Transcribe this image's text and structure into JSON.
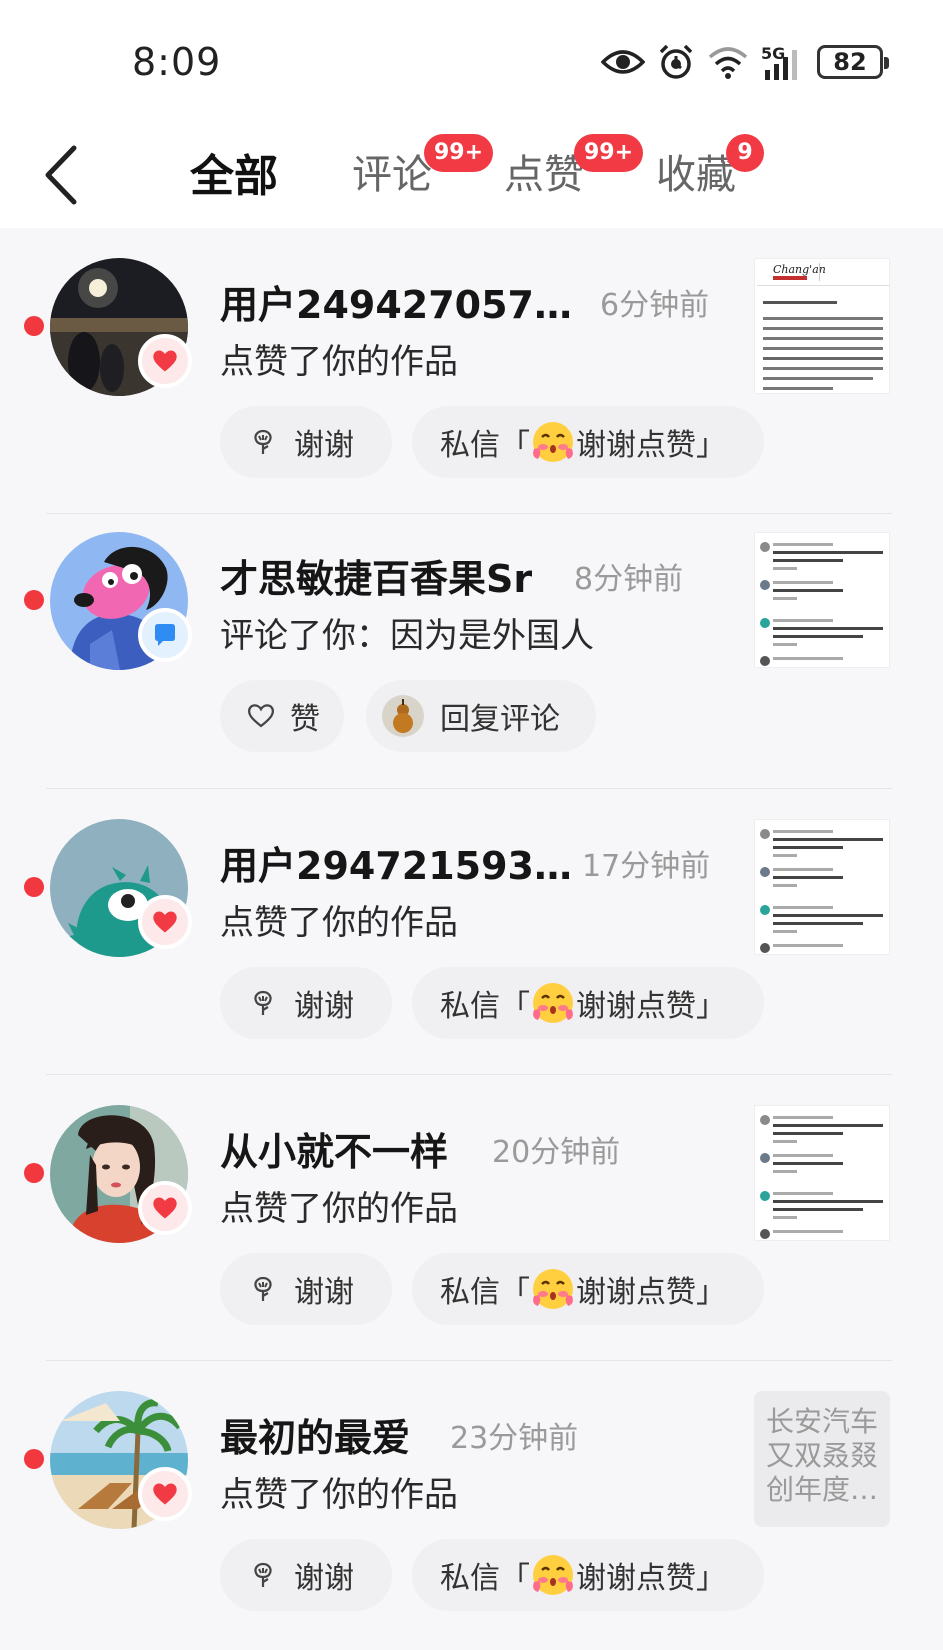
{
  "status_bar": {
    "time": "8:09",
    "network": "5G",
    "battery": "82",
    "icons": [
      "eye-icon",
      "alarm-icon",
      "wifi-icon",
      "signal-icon",
      "battery-icon"
    ]
  },
  "header": {
    "back_icon": "chevron-left-icon",
    "tabs": [
      {
        "label": "全部",
        "active": true,
        "badge": ""
      },
      {
        "label": "评论",
        "active": false,
        "badge": "99+"
      },
      {
        "label": "点赞",
        "active": false,
        "badge": "99+"
      },
      {
        "label": "收藏",
        "active": false,
        "badge": "9"
      }
    ]
  },
  "colors": {
    "accent": "#f23a44",
    "unread_dot": "#f2383f",
    "pill_bg": "#f0f0f2",
    "muted_text": "#9a9a9a"
  },
  "notifications": [
    {
      "user": "用户249427057…",
      "time": "6分钟前",
      "action": "点赞了你的作品",
      "badge_icon": "heart-icon",
      "thumb_kind": "article",
      "thumb_header": "Chang'an",
      "buttons": [
        {
          "icon": "thanks-flower-icon",
          "label": "谢谢"
        },
        {
          "icon": "blush-emoji-icon",
          "label": "私信「",
          "emoji_label": "谢谢点赞」"
        }
      ]
    },
    {
      "user": "才思敏捷百香果Sr",
      "time": "8分钟前",
      "action": "评论了你：因为是外国人",
      "badge_icon": "comment-bubble-icon",
      "thumb_kind": "comments",
      "buttons": [
        {
          "icon": "heart-outline-icon",
          "label": "赞"
        },
        {
          "icon": "gourd-avatar-icon",
          "label": "回复评论"
        }
      ]
    },
    {
      "user": "用户294721593…",
      "time": "17分钟前",
      "action": "点赞了你的作品",
      "badge_icon": "heart-icon",
      "thumb_kind": "comments",
      "buttons": [
        {
          "icon": "thanks-flower-icon",
          "label": "谢谢"
        },
        {
          "icon": "blush-emoji-icon",
          "label": "私信「",
          "emoji_label": "谢谢点赞」"
        }
      ]
    },
    {
      "user": "从小就不一样",
      "time": "20分钟前",
      "action": "点赞了你的作品",
      "badge_icon": "heart-icon",
      "thumb_kind": "comments",
      "buttons": [
        {
          "icon": "thanks-flower-icon",
          "label": "谢谢"
        },
        {
          "icon": "blush-emoji-icon",
          "label": "私信「",
          "emoji_label": "谢谢点赞」"
        }
      ]
    },
    {
      "user": "最初的最爱",
      "time": "23分钟前",
      "action": "点赞了你的作品",
      "badge_icon": "heart-icon",
      "thumb_kind": "text",
      "thumb_text": "长安汽车又双叒叕创年度…",
      "buttons": [
        {
          "icon": "thanks-flower-icon",
          "label": "谢谢"
        },
        {
          "icon": "blush-emoji-icon",
          "label": "私信「",
          "emoji_label": "谢谢点赞」"
        }
      ]
    }
  ]
}
